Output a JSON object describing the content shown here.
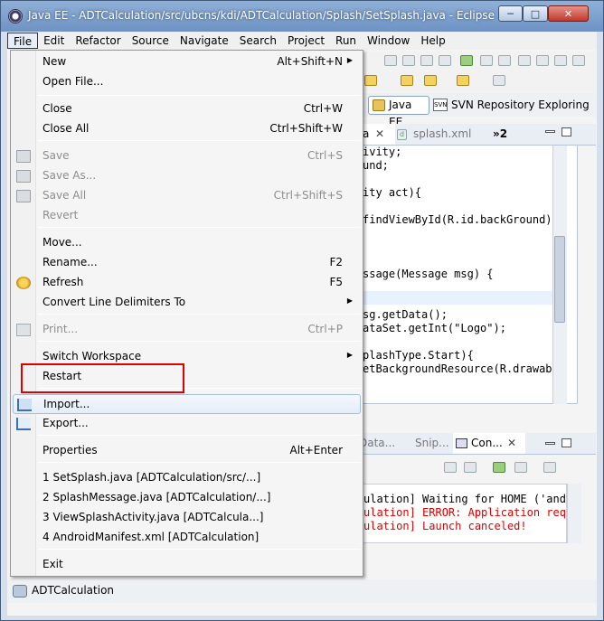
{
  "window": {
    "title": "Java EE - ADTCalculation/src/ubcns/kdi/ADTCalculation/Splash/SetSplash.java - Eclipse",
    "minimize_glyph": "─",
    "maximize_glyph": "□",
    "close_glyph": "✕"
  },
  "menubar": {
    "items": [
      "File",
      "Edit",
      "Refactor",
      "Source",
      "Navigate",
      "Search",
      "Project",
      "Run",
      "Window",
      "Help"
    ],
    "active": "File"
  },
  "perspectives": {
    "java_ee": "Java EE",
    "svn_icon_text": "SVN",
    "svn": "SVN Repository Exploring"
  },
  "editor": {
    "active_tab_label": "a",
    "active_tab_close": "✕",
    "second_tab": "splash.xml",
    "second_tab_icon": "d",
    "more_tabs": "»2",
    "code_lines": [
      "ivity;",
      "und;",
      "",
      "ity act){",
      "",
      "findViewById(R.id.backGround);",
      "",
      "",
      "",
      "ssage(Message msg) {",
      "",
      "",
      "sg.getData();",
      "ataSet.getInt(\"Logo\");",
      "",
      "plashType.Start){",
      "etBackgroundResource(R.drawable"
    ]
  },
  "console": {
    "tabs": [
      "Data...",
      "Snip...",
      "Con..."
    ],
    "active_tab": "Con...",
    "close_glyph": "✕",
    "lines": [
      {
        "text": "ulation] Waiting for HOME ('andr",
        "error": false
      },
      {
        "text": "ulation] ERROR: Application requ",
        "error": true
      },
      {
        "text": "ulation] Launch canceled!",
        "error": true
      }
    ]
  },
  "statusbar": {
    "text": "ADTCalculation"
  },
  "file_menu": {
    "items": [
      {
        "label": "New",
        "accel": "Alt+Shift+N",
        "submenu": true,
        "disabled": false,
        "icon": ""
      },
      {
        "label": "Open File...",
        "accel": "",
        "submenu": false,
        "disabled": false,
        "icon": ""
      },
      {
        "label": "Close",
        "accel": "Ctrl+W",
        "submenu": false,
        "disabled": false,
        "icon": ""
      },
      {
        "label": "Close All",
        "accel": "Ctrl+Shift+W",
        "submenu": false,
        "disabled": false,
        "icon": ""
      },
      {
        "label": "Save",
        "accel": "Ctrl+S",
        "submenu": false,
        "disabled": true,
        "icon": "save-icon"
      },
      {
        "label": "Save As...",
        "accel": "",
        "submenu": false,
        "disabled": true,
        "icon": "save-as-icon"
      },
      {
        "label": "Save All",
        "accel": "Ctrl+Shift+S",
        "submenu": false,
        "disabled": true,
        "icon": "save-all-icon"
      },
      {
        "label": "Revert",
        "accel": "",
        "submenu": false,
        "disabled": true,
        "icon": ""
      },
      {
        "label": "Move...",
        "accel": "",
        "submenu": false,
        "disabled": false,
        "icon": ""
      },
      {
        "label": "Rename...",
        "accel": "F2",
        "submenu": false,
        "disabled": false,
        "icon": ""
      },
      {
        "label": "Refresh",
        "accel": "F5",
        "submenu": false,
        "disabled": false,
        "icon": "refresh-icon"
      },
      {
        "label": "Convert Line Delimiters To",
        "accel": "",
        "submenu": true,
        "disabled": false,
        "icon": ""
      },
      {
        "label": "Print...",
        "accel": "Ctrl+P",
        "submenu": false,
        "disabled": true,
        "icon": "print-icon"
      },
      {
        "label": "Switch Workspace",
        "accel": "",
        "submenu": true,
        "disabled": false,
        "icon": ""
      },
      {
        "label": "Restart",
        "accel": "",
        "submenu": false,
        "disabled": false,
        "icon": ""
      },
      {
        "label": "Import...",
        "accel": "",
        "submenu": false,
        "disabled": false,
        "icon": "import-icon"
      },
      {
        "label": "Export...",
        "accel": "",
        "submenu": false,
        "disabled": false,
        "icon": "export-icon"
      },
      {
        "label": "Properties",
        "accel": "Alt+Enter",
        "submenu": false,
        "disabled": false,
        "icon": ""
      },
      {
        "label": "1 SetSplash.java  [ADTCalculation/src/...]",
        "accel": "",
        "submenu": false,
        "disabled": false,
        "icon": ""
      },
      {
        "label": "2 SplashMessage.java  [ADTCalculation/...]",
        "accel": "",
        "submenu": false,
        "disabled": false,
        "icon": ""
      },
      {
        "label": "3 ViewSplashActivity.java  [ADTCalcula...]",
        "accel": "",
        "submenu": false,
        "disabled": false,
        "icon": ""
      },
      {
        "label": "4 AndroidManifest.xml  [ADTCalculation]",
        "accel": "",
        "submenu": false,
        "disabled": false,
        "icon": ""
      },
      {
        "label": "Exit",
        "accel": "",
        "submenu": false,
        "disabled": false,
        "icon": ""
      }
    ],
    "hovered_item": "Import...",
    "highlighted_item": "Restart",
    "highlight_color": "#e00000"
  }
}
